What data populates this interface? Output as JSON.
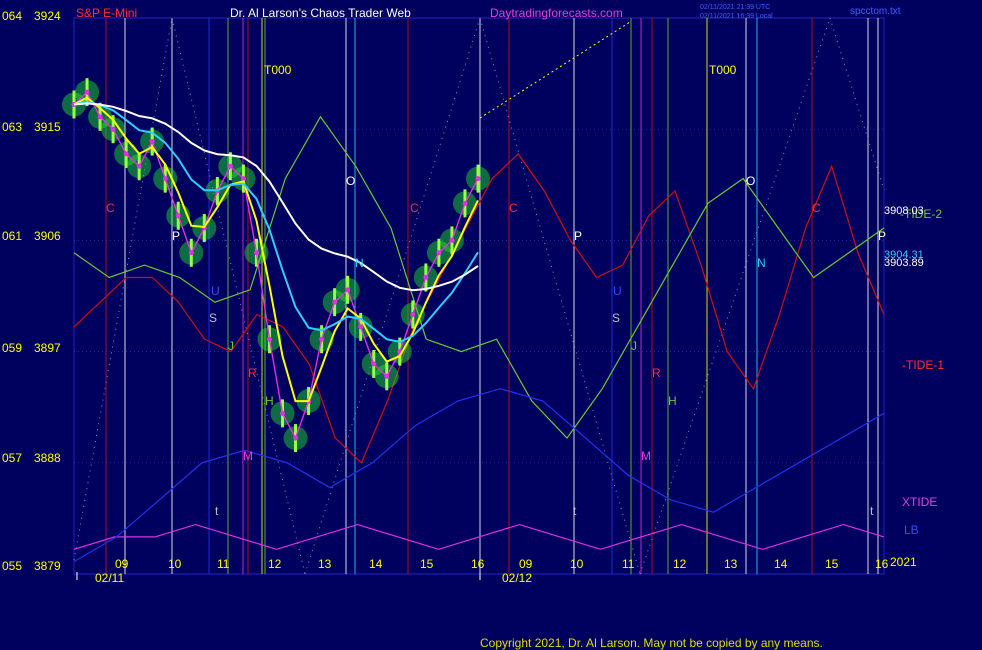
{
  "header": {
    "instrument": "S&P E-Mini",
    "title": "Dr. Al Larson's Chaos Trader Web",
    "site": "Daytradingforecasts.com",
    "timestamp_utc": "02/11/2021 21:39 UTC",
    "timestamp_local": "02/11/2021 16:39 Local",
    "file": "spcctom.txt"
  },
  "colors": {
    "background": "#00005f",
    "price_bars": "#22ee22",
    "ema_fast": "#ffff00",
    "ema_mid": "#33ccff",
    "ema_slow": "#ffffff",
    "tide1": "#cc1111",
    "tide2": "#66cc33",
    "xtide": "#e030e0",
    "lb": "#2233ee",
    "copyright": "#dddd00"
  },
  "y_axis": {
    "labels": [
      {
        "left": "064",
        "price": "3924"
      },
      {
        "left": "063",
        "price": "3915"
      },
      {
        "left": "061",
        "price": "3906"
      },
      {
        "left": "059",
        "price": "3897"
      },
      {
        "left": "057",
        "price": "3888"
      },
      {
        "left": "055",
        "price": "3879"
      }
    ]
  },
  "x_axis": {
    "hours": [
      "09",
      "10",
      "11",
      "12",
      "13",
      "14",
      "15",
      "16",
      "09",
      "10",
      "11",
      "12",
      "13",
      "14",
      "15",
      "16"
    ],
    "dates": [
      "02/11",
      "02/12"
    ],
    "year": "2021"
  },
  "right_labels": {
    "tide2": "-TIDE-2",
    "tide1": "-TIDE-1",
    "xtide": "XTIDE",
    "lb": "LB",
    "price_a": "3908.03",
    "price_b": "3904.31",
    "price_c": "3903.89"
  },
  "markers": {
    "T000_a": "T000",
    "T000_b": "T000",
    "C": "C",
    "P": "P",
    "U": "U",
    "S": "S",
    "J": "J",
    "R": "R",
    "H": "H",
    "M": "M",
    "t": "t",
    "O": "O",
    "N": "N"
  },
  "copyright": "Copyright 2021, Dr. Al Larson. May not be copied by any means.",
  "chart_data": {
    "type": "line",
    "title": "S&P E-Mini",
    "ylim": [
      3879,
      3924
    ],
    "y_ticks": [
      3924,
      3915,
      3906,
      3897,
      3888,
      3879
    ],
    "x_ticks": [
      "09",
      "10",
      "11",
      "12",
      "13",
      "14",
      "15",
      "16",
      "09",
      "10",
      "11",
      "12",
      "13",
      "14",
      "15",
      "16"
    ],
    "x_dates": [
      "02/11",
      "02/12"
    ],
    "legend": [
      "-TIDE-2",
      "-TIDE-1",
      "XTIDE",
      "LB"
    ],
    "series": [
      {
        "name": "price",
        "values": [
          3917,
          3918,
          3916,
          3915,
          3913,
          3912,
          3914,
          3911,
          3908,
          3905,
          3907,
          3910,
          3912,
          3911,
          3905,
          3898,
          3892,
          3890,
          3893,
          3898,
          3901,
          3902,
          3899,
          3896,
          3895,
          3897,
          3900,
          3903,
          3905,
          3906,
          3909,
          3911
        ]
      },
      {
        "name": "-TIDE-1",
        "values": [
          3899,
          3901,
          3903,
          3903,
          3901,
          3898,
          3897,
          3900,
          3899,
          3896,
          3890,
          3888,
          3893,
          3899,
          3903,
          3907,
          3911,
          3913,
          3910,
          3906,
          3903,
          3904,
          3908,
          3910,
          3904,
          3897,
          3894,
          3900,
          3907,
          3912,
          3905,
          3900
        ]
      },
      {
        "name": "-TIDE-2",
        "values": [
          3905,
          3903,
          3904,
          3903,
          3901,
          3902,
          3911,
          3916,
          3912,
          3907,
          3898,
          3897,
          3898,
          3893,
          3890,
          3894,
          3899,
          3904,
          3909,
          3911,
          3907,
          3903,
          3905,
          3907
        ]
      },
      {
        "name": "XTIDE",
        "values": [
          3881,
          3882,
          3882,
          3883,
          3882,
          3881,
          3882,
          3883,
          3882,
          3881,
          3882,
          3883,
          3882,
          3881,
          3882,
          3883,
          3882,
          3881,
          3882,
          3883,
          3882
        ]
      },
      {
        "name": "LB",
        "values": [
          3880,
          3882,
          3885,
          3888,
          3889,
          3888,
          3886,
          3888,
          3891,
          3893,
          3894,
          3893,
          3890,
          3887,
          3885,
          3884,
          3886,
          3888,
          3890,
          3892
        ]
      }
    ]
  }
}
